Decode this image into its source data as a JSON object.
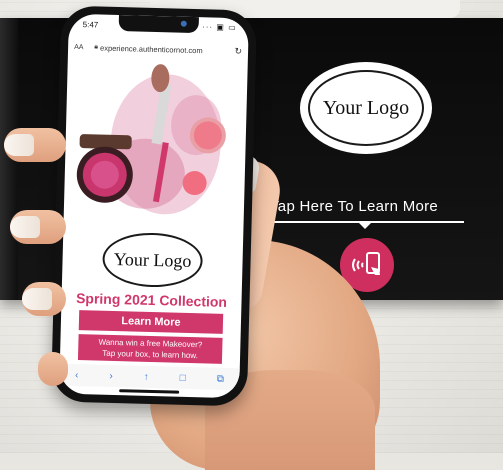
{
  "box": {
    "logo_text": "Your Logo",
    "tap_text": "Tap Here To Learn More",
    "nfc_icon": "nfc-tap-icon"
  },
  "phone": {
    "status": {
      "time": "5:47",
      "icons": "··· ▣ ▭"
    },
    "browser": {
      "aa_label": "AA",
      "url": "experience.authenticornot.com"
    },
    "page": {
      "logo_text": "Your Logo",
      "collection_title": "Spring 2021 Collection",
      "button_label": "Learn More",
      "promo_line1": "Wanna win a free Makeover?",
      "promo_line2": "Tap your box, to learn how."
    },
    "toolbar": {
      "back": "‹",
      "forward": "›",
      "share": "↑",
      "bookmarks": "□",
      "tabs": "⧉"
    }
  },
  "colors": {
    "accent_pink": "#d0376a",
    "box_black": "#0a0a0a",
    "link_blue": "#3a7bd5"
  }
}
